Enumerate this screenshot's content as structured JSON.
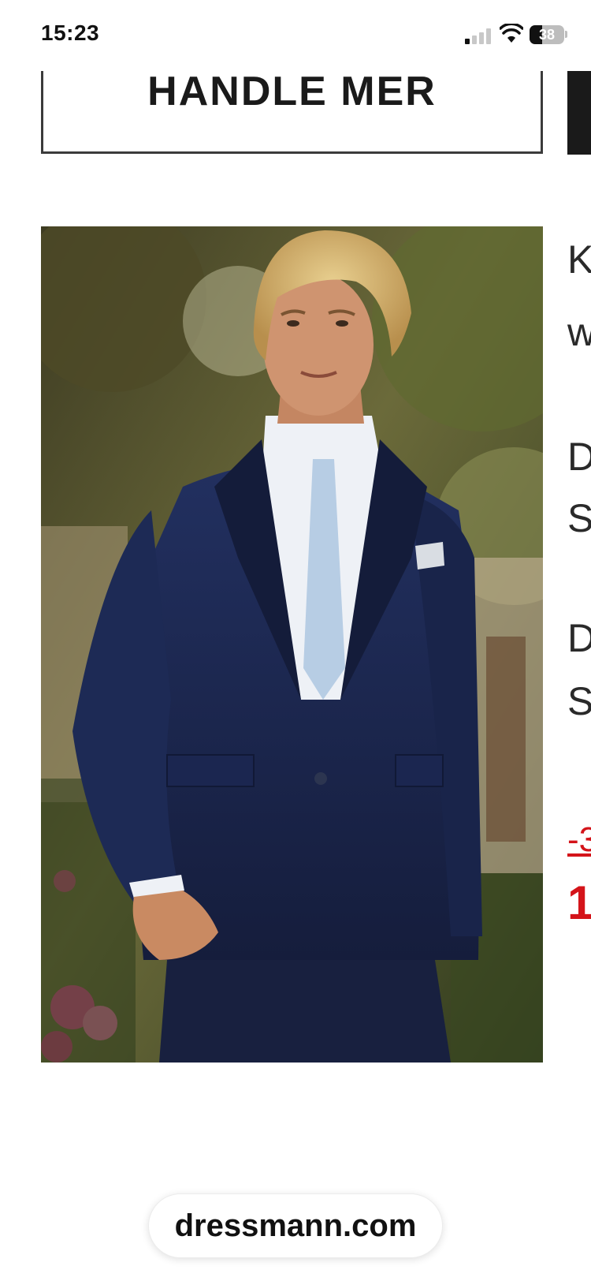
{
  "status_bar": {
    "time": "15:23",
    "battery": "38"
  },
  "cta": {
    "label": "HANDLE MER"
  },
  "side_column": {
    "lines": [
      "K",
      "w",
      "D",
      "S",
      "D",
      "S"
    ],
    "discount": "-3",
    "price": "1"
  },
  "browser": {
    "url": "dressmann.com"
  },
  "colors": {
    "sale_red": "#d4141a",
    "suit_navy": "#1e2a4e"
  },
  "icons": {
    "signal": "cellular-signal-icon",
    "wifi": "wifi-icon",
    "battery": "battery-icon"
  }
}
